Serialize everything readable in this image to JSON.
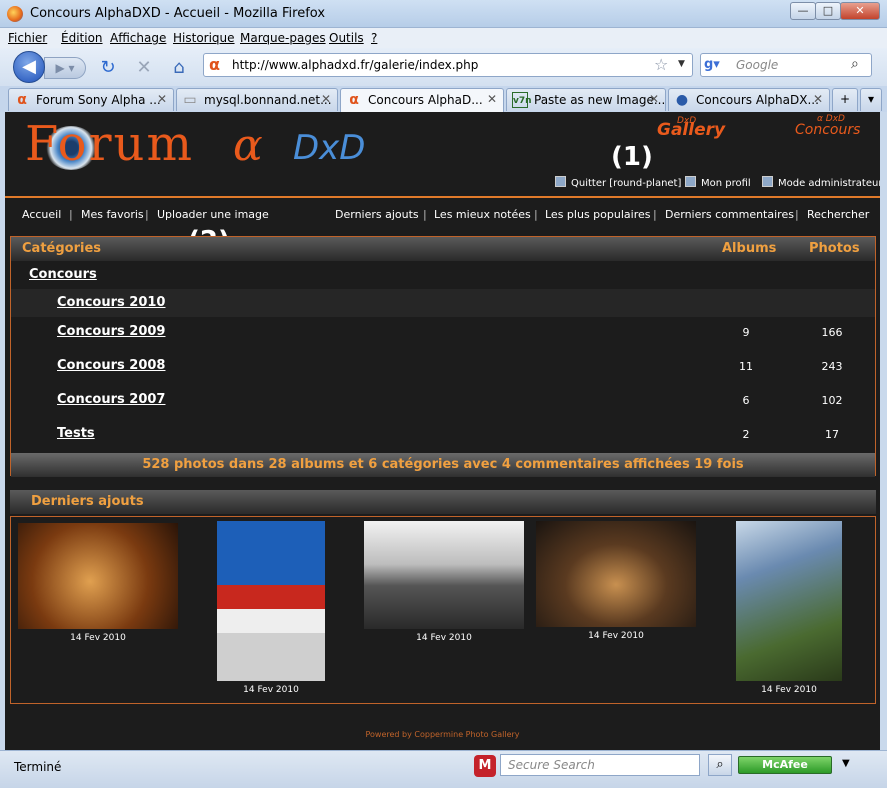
{
  "window": {
    "title": "Concours AlphaDXD - Accueil - Mozilla Firefox"
  },
  "menu": [
    "Fichier",
    "Édition",
    "Affichage",
    "Historique",
    "Marque-pages",
    "Outils",
    "?"
  ],
  "address_bar": {
    "url": "http://www.alphadxd.fr/galerie/index.php"
  },
  "search_bar": {
    "placeholder": "Google"
  },
  "tabs": [
    {
      "label": "Forum Sony Alpha ...",
      "icon": "alpha-icon"
    },
    {
      "label": "mysql.bonnand.net...",
      "icon": "page-icon"
    },
    {
      "label": "Concours AlphaD...",
      "icon": "alpha-icon",
      "active": true
    },
    {
      "label": "Paste as new Image...",
      "icon": "v7n-icon"
    },
    {
      "label": "Concours AlphaDX...",
      "icon": "globe-icon"
    }
  ],
  "header": {
    "logo_forum": "Forum",
    "logo_alpha": "α",
    "logo_dxd": "DxD",
    "gallery_logo": "Gallery",
    "gallery_logo_sub": "DxD",
    "concours_logo": "Concours",
    "concours_logo_sub": "α DxD",
    "annotation_1": "(1)",
    "annotation_2": "(2)"
  },
  "user_links": {
    "quit": "Quitter [round-planet]",
    "profile": "Mon profil",
    "admin": "Mode administrateur"
  },
  "nav": {
    "left": [
      "Accueil",
      "Mes favoris",
      "Uploader une image"
    ],
    "right": [
      "Derniers ajouts",
      "Les mieux notées",
      "Les plus populaires",
      "Derniers commentaires",
      "Rechercher"
    ]
  },
  "categories": {
    "header": {
      "name": "Catégories",
      "albums": "Albums",
      "photos": "Photos"
    },
    "parent": "Concours",
    "rows": [
      {
        "name": "Concours 2010",
        "albums": "",
        "photos": ""
      },
      {
        "name": "Concours 2009",
        "albums": "9",
        "photos": "166"
      },
      {
        "name": "Concours 2008",
        "albums": "11",
        "photos": "243"
      },
      {
        "name": "Concours 2007",
        "albums": "6",
        "photos": "102"
      },
      {
        "name": "Tests",
        "albums": "2",
        "photos": "17"
      }
    ],
    "stats": "528 photos dans 28 albums et 6 catégories avec 4 commentaires affichées 19 fois"
  },
  "latest": {
    "title": "Derniers ajouts",
    "items": [
      {
        "caption": "14 Fev 2010",
        "colors": [
          "#7a3a10",
          "#d88a30"
        ]
      },
      {
        "caption": "14 Fev 2010",
        "colors": [
          "#1d5fb8",
          "#c8281e"
        ]
      },
      {
        "caption": "14 Fev 2010",
        "colors": [
          "#eeeeee",
          "#3a3a3a"
        ]
      },
      {
        "caption": "14 Fev 2010",
        "colors": [
          "#2a2018",
          "#b07a40"
        ]
      },
      {
        "caption": "14 Fev 2010",
        "colors": [
          "#6a8ab0",
          "#4a6a30"
        ]
      }
    ]
  },
  "footer": "Powered by Coppermine Photo Gallery",
  "statusbar": {
    "status": "Terminé",
    "secure_search_placeholder": "Secure Search",
    "mcafee_label": "McAfee"
  },
  "colors": {
    "accent": "#e07a2a",
    "header_text": "#f0a040",
    "page_bg": "#1c1c1c"
  }
}
